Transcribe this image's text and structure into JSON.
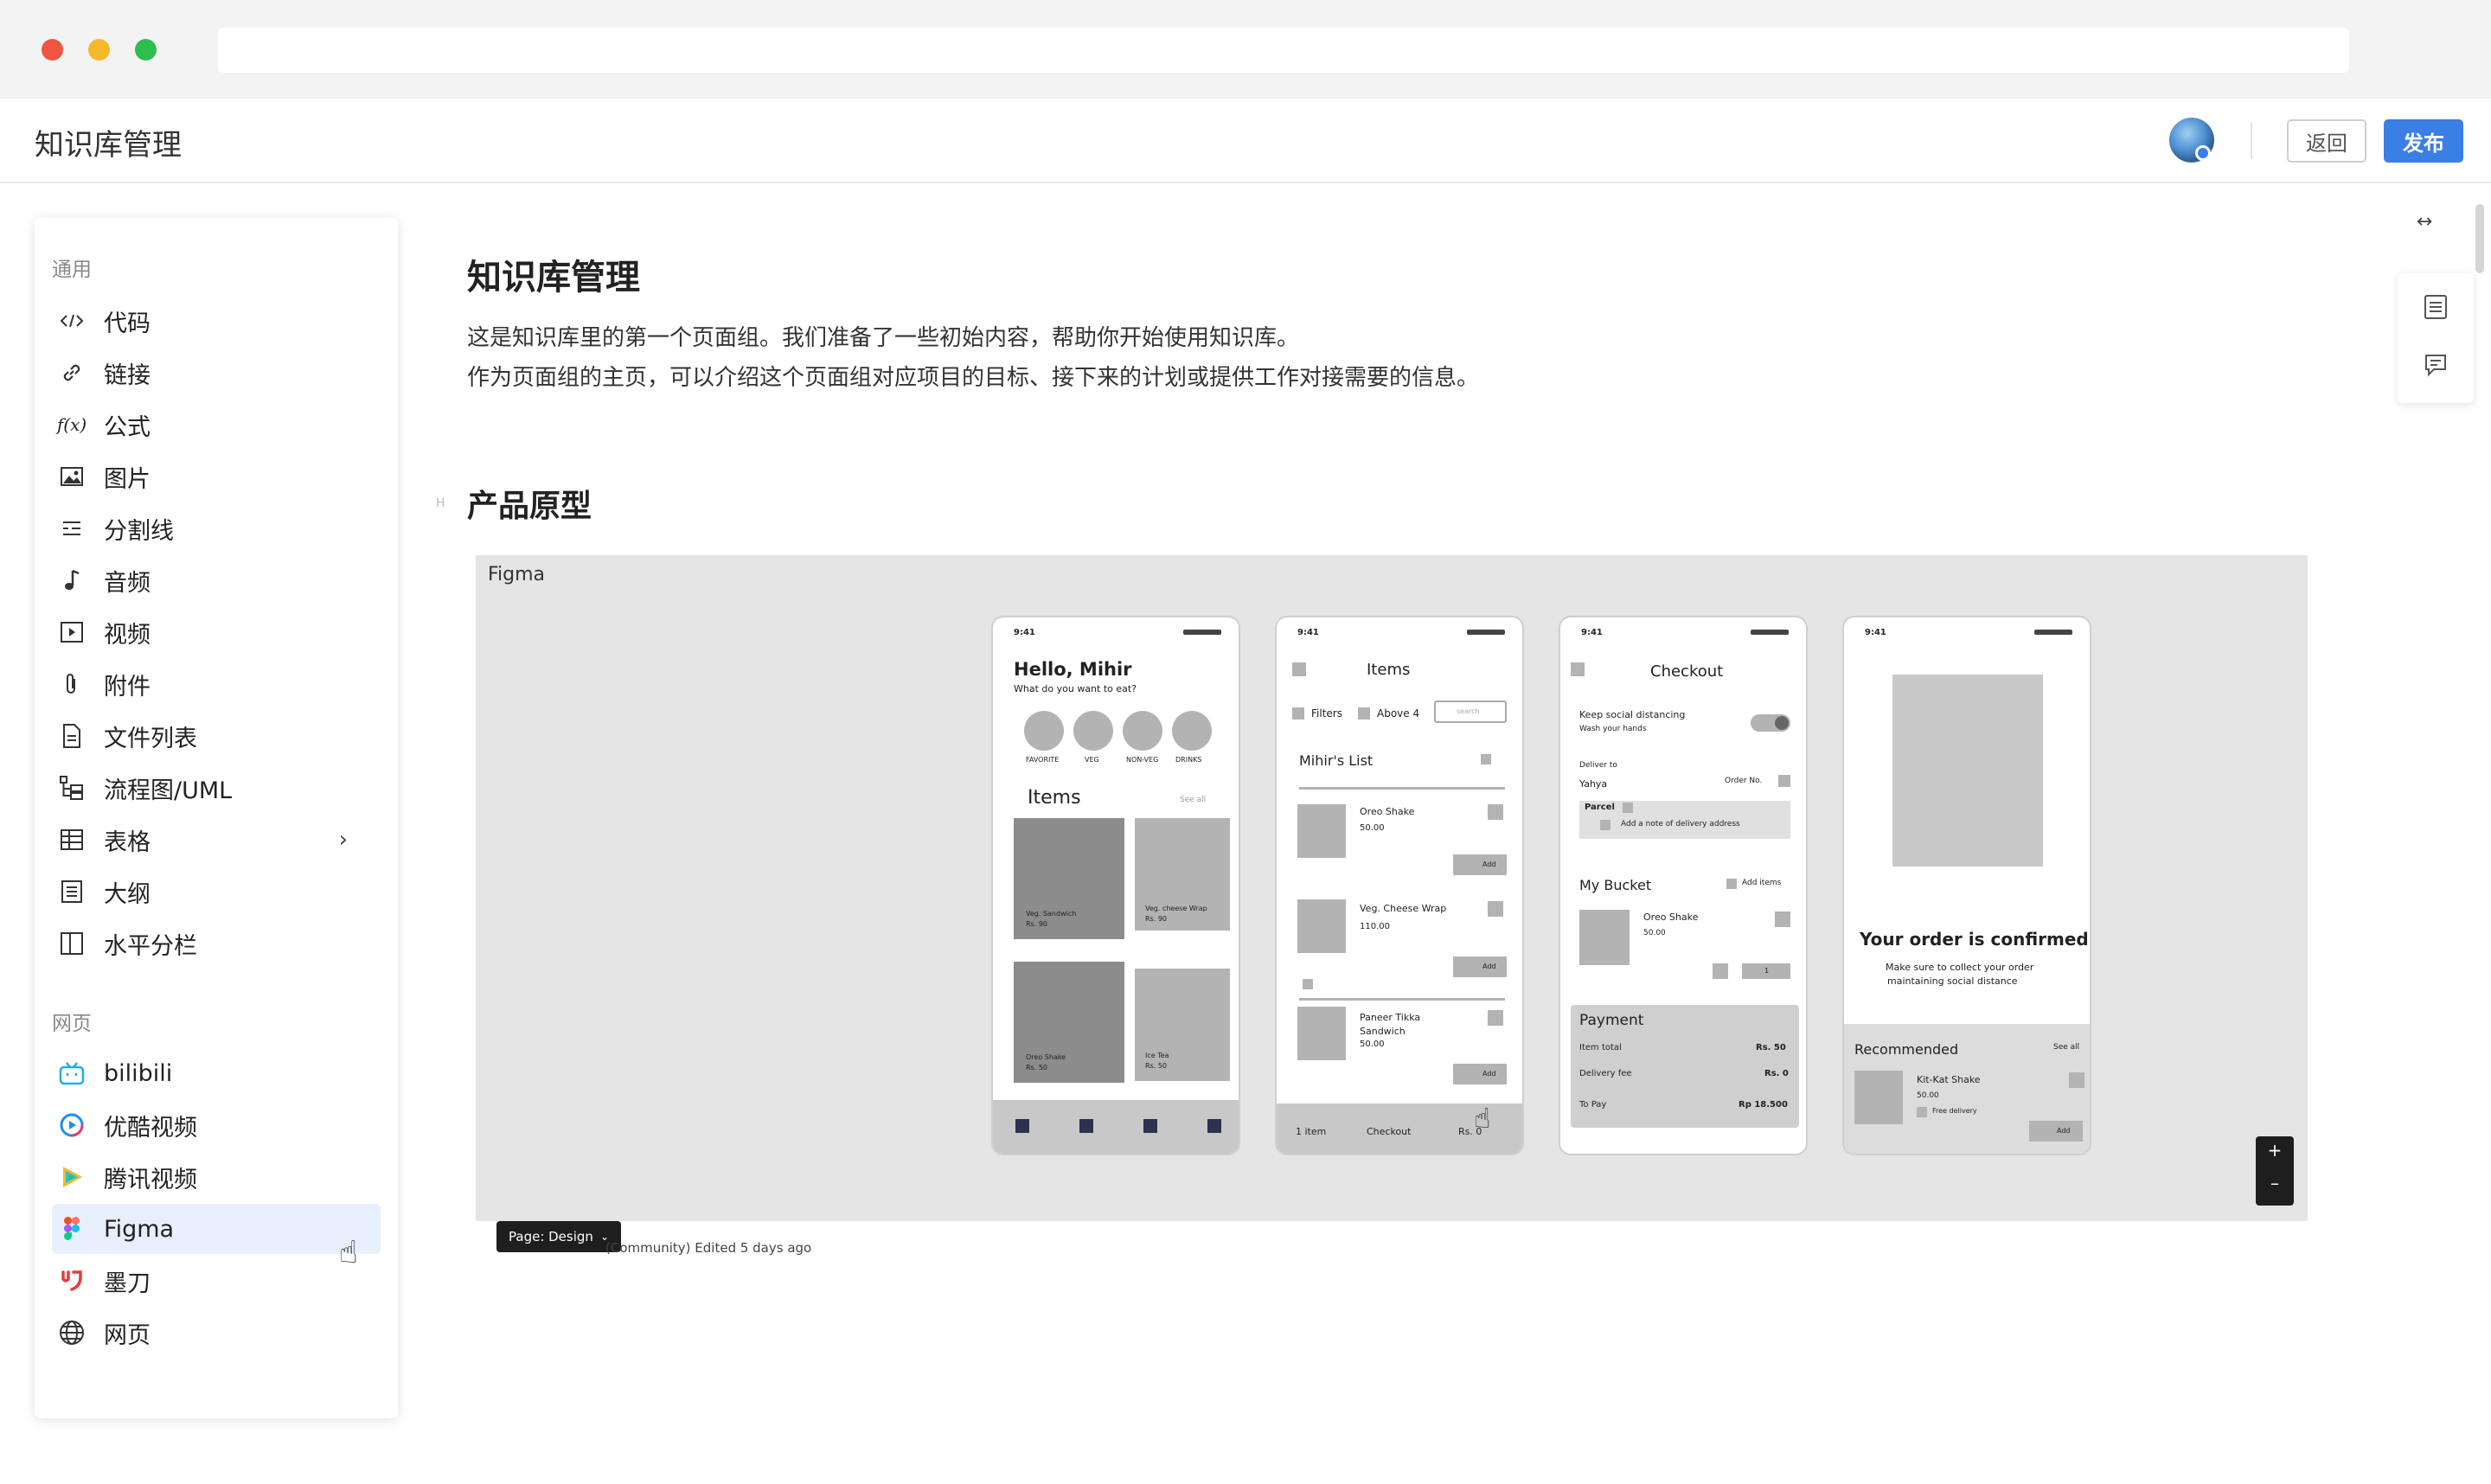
{
  "window": {
    "dots": [
      "#f0553f",
      "#f5b829",
      "#2dbe4e"
    ]
  },
  "header": {
    "title": "知识库管理",
    "back_label": "返回",
    "publish_label": "发布"
  },
  "menu": {
    "section_general": "通用",
    "general_items": [
      {
        "label": "代码",
        "icon": "code-icon"
      },
      {
        "label": "链接",
        "icon": "link-icon"
      },
      {
        "label": "公式",
        "icon": "formula-icon"
      },
      {
        "label": "图片",
        "icon": "image-icon"
      },
      {
        "label": "分割线",
        "icon": "divider-icon"
      },
      {
        "label": "音频",
        "icon": "audio-icon"
      },
      {
        "label": "视频",
        "icon": "video-icon"
      },
      {
        "label": "附件",
        "icon": "attachment-icon"
      },
      {
        "label": "文件列表",
        "icon": "file-list-icon"
      },
      {
        "label": "流程图/UML",
        "icon": "flowchart-icon"
      },
      {
        "label": "表格",
        "icon": "table-icon"
      },
      {
        "label": "大纲",
        "icon": "outline-icon"
      },
      {
        "label": "水平分栏",
        "icon": "columns-icon"
      }
    ],
    "section_web": "网页",
    "web_items": [
      {
        "label": "bilibili",
        "icon": "bilibili-icon"
      },
      {
        "label": "优酷视频",
        "icon": "youku-icon"
      },
      {
        "label": "腾讯视频",
        "icon": "tencent-video-icon"
      },
      {
        "label": "Figma",
        "icon": "figma-icon"
      },
      {
        "label": "墨刀",
        "icon": "modao-icon"
      },
      {
        "label": "网页",
        "icon": "globe-icon"
      }
    ]
  },
  "doc": {
    "title": "知识库管理",
    "para1": "这是知识库里的第一个页面组。我们准备了一些初始内容，帮助你开始使用知识库。",
    "para2": "作为页面组的主页，可以介绍这个页面组对应项目的目标、接下来的计划或提供工作对接需要的信息。",
    "section_heading": "产品原型",
    "heading_mark": "H"
  },
  "figma": {
    "label": "Figma",
    "page_label": "Page: Design",
    "footer": "(Community) Edited 5 days ago",
    "zoom_in": "+",
    "zoom_out": "–",
    "phones": {
      "status_time": "9:41",
      "p1": {
        "greeting": "Hello, Mihir",
        "sub": "What do you want to eat?",
        "cats": [
          "FAVORITE",
          "VEG",
          "NON-VEG",
          "DRINKS"
        ],
        "items": "Items",
        "see_all": "See all",
        "cards": [
          [
            "Veg. Sandwich",
            "Rs. 90"
          ],
          [
            "Veg. cheese Wrap",
            "Rs. 90"
          ],
          [
            "Oreo Shake",
            "Rs. 50"
          ],
          [
            "Ice Tea",
            "Rs. 50"
          ]
        ]
      },
      "p2": {
        "title": "Items",
        "filters": "Filters",
        "above": "Above 4",
        "search": "search",
        "list": "Mihir's List",
        "entries": [
          [
            "Oreo Shake",
            "50.00"
          ],
          [
            "Veg. Cheese Wrap",
            "110.00"
          ],
          [
            "Paneer Tikka",
            "Sandwich",
            "50.00"
          ]
        ],
        "add": "Add",
        "footer": [
          "1 item",
          "Checkout",
          "Rs. 0"
        ]
      },
      "p3": {
        "title": "Checkout",
        "keep": "Keep social distancing",
        "wash": "Wash your hands",
        "deliver_to": "Deliver to",
        "name": "Yahya",
        "order": "Order No.",
        "parcel": "Parcel",
        "note": "Add a note of delivery address",
        "bucket": "My Bucket",
        "add_items": "Add items",
        "item": "Oreo Shake",
        "item_price": "50.00",
        "qty": "1",
        "payment": "Payment",
        "rows": [
          [
            "Item total",
            "Rs. 50"
          ],
          [
            "Delivery fee",
            "Rs. 0"
          ],
          [
            "To Pay",
            "Rp 18.500"
          ]
        ]
      },
      "p4": {
        "confirmed": "Your order is confirmed!",
        "msg1": "Make sure to collect your order",
        "msg2": "maintaining social distance",
        "rec": "Recommended",
        "see_all": "See all",
        "item": "Kit-Kat Shake",
        "price": "50.00",
        "free": "Free delivery",
        "add": "Add"
      }
    }
  },
  "tools": {
    "expand": "↔"
  }
}
